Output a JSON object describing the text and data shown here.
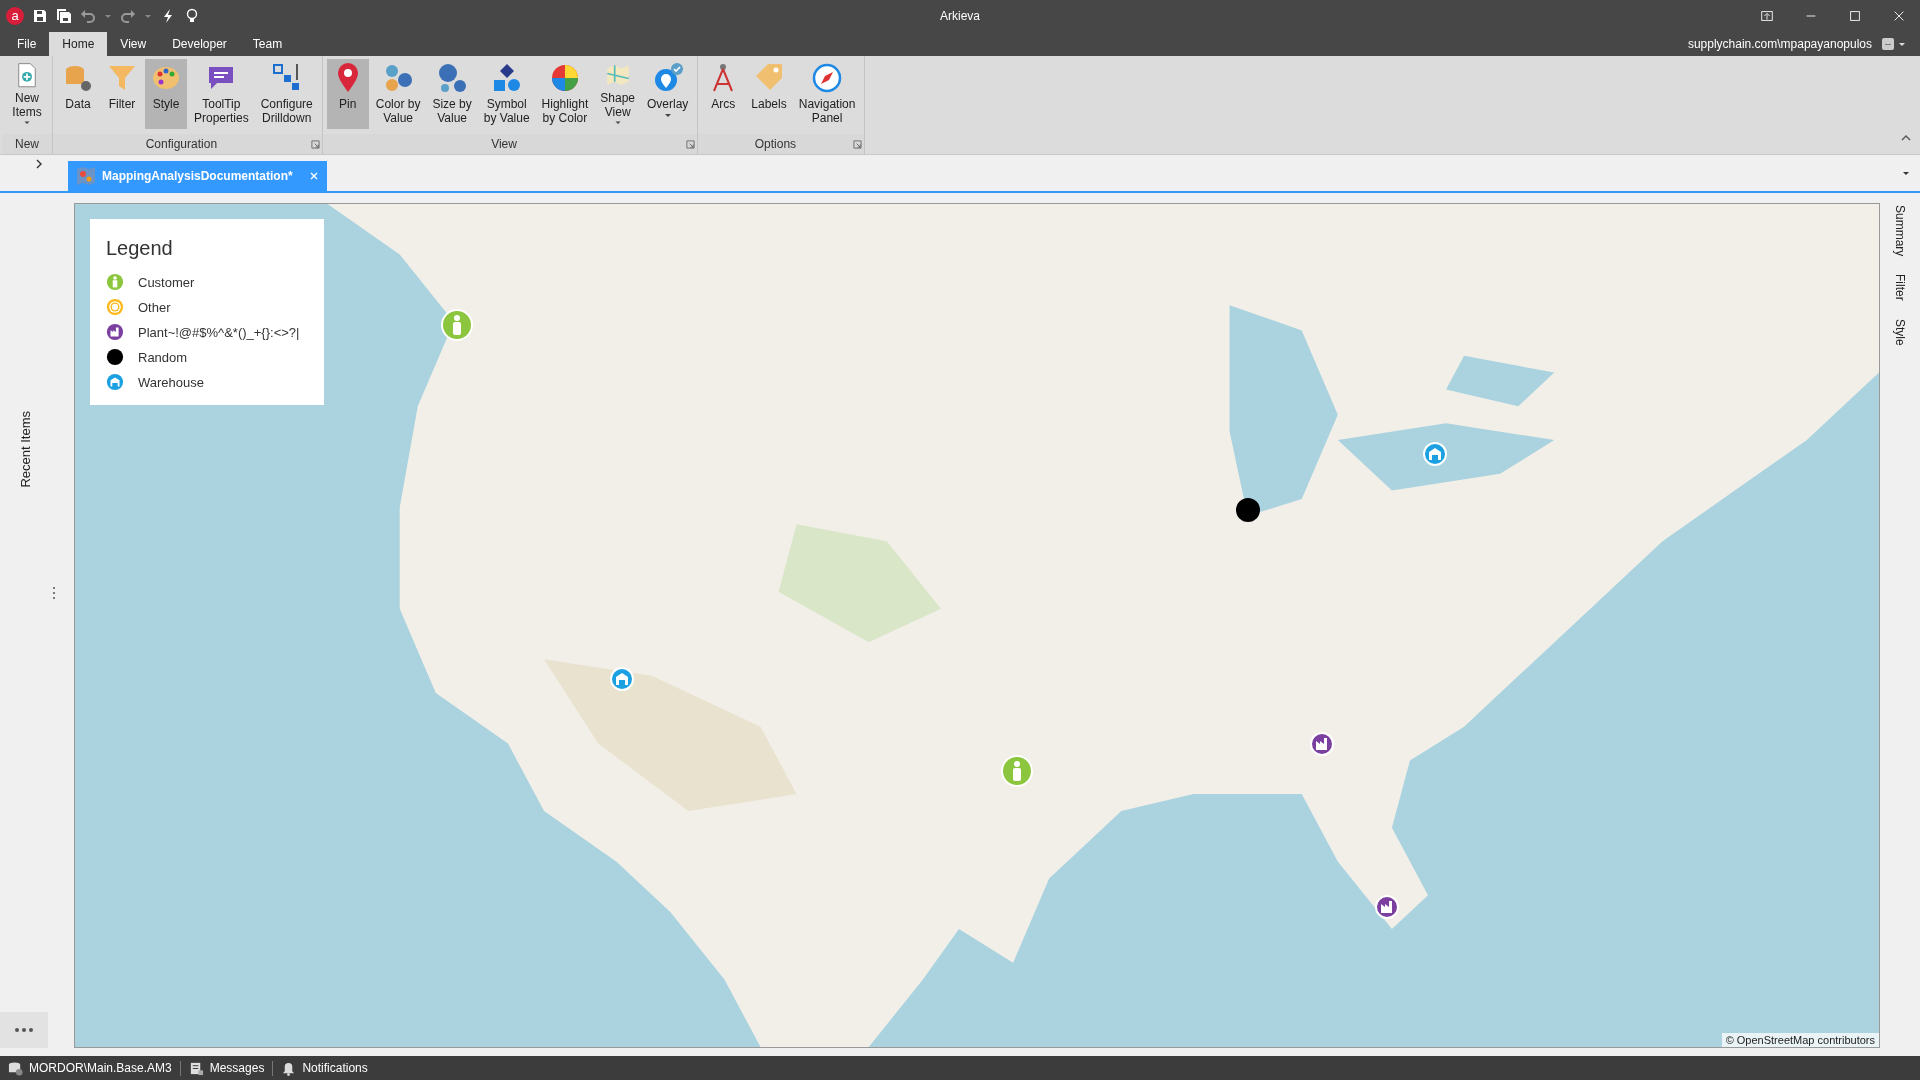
{
  "window": {
    "logo_letter": "a",
    "title": "Arkieva"
  },
  "menu_tabs": [
    {
      "label": "File",
      "selected": false
    },
    {
      "label": "Home",
      "selected": true
    },
    {
      "label": "View",
      "selected": false
    },
    {
      "label": "Developer",
      "selected": false
    },
    {
      "label": "Team",
      "selected": false
    }
  ],
  "account": {
    "user": "supplychain.com\\mpapayanopulos",
    "badge": "--"
  },
  "ribbon_groups": [
    {
      "label": "New",
      "launcher": false,
      "buttons": [
        {
          "kind": "new",
          "lines": [
            "New",
            "Items"
          ],
          "dropdown": true,
          "selected": false
        }
      ]
    },
    {
      "label": "Configuration",
      "launcher": true,
      "buttons": [
        {
          "kind": "data",
          "lines": [
            "Data"
          ],
          "dropdown": false,
          "selected": false
        },
        {
          "kind": "filter",
          "lines": [
            "Filter"
          ],
          "dropdown": false,
          "selected": false
        },
        {
          "kind": "style",
          "lines": [
            "Style"
          ],
          "dropdown": false,
          "selected": true
        },
        {
          "kind": "tooltip",
          "lines": [
            "ToolTip",
            "Properties"
          ],
          "dropdown": false,
          "selected": false
        },
        {
          "kind": "drilldown",
          "lines": [
            "Configure",
            "Drilldown"
          ],
          "dropdown": false,
          "selected": false
        }
      ]
    },
    {
      "label": "View",
      "launcher": true,
      "buttons": [
        {
          "kind": "pin",
          "lines": [
            "Pin"
          ],
          "dropdown": false,
          "selected": true
        },
        {
          "kind": "color",
          "lines": [
            "Color by",
            "Value"
          ],
          "dropdown": false,
          "selected": false
        },
        {
          "kind": "size",
          "lines": [
            "Size by",
            "Value"
          ],
          "dropdown": false,
          "selected": false
        },
        {
          "kind": "symbol",
          "lines": [
            "Symbol",
            "by Value"
          ],
          "dropdown": false,
          "selected": false
        },
        {
          "kind": "highlight",
          "lines": [
            "Highlight",
            "by Color"
          ],
          "dropdown": false,
          "selected": false
        },
        {
          "kind": "shape",
          "lines": [
            "Shape",
            "View"
          ],
          "dropdown": true,
          "selected": false
        },
        {
          "kind": "overlay",
          "lines": [
            "Overlay"
          ],
          "dropdown": true,
          "selected": false
        }
      ]
    },
    {
      "label": "Options",
      "launcher": true,
      "buttons": [
        {
          "kind": "arcs",
          "lines": [
            "Arcs"
          ],
          "dropdown": false,
          "selected": false
        },
        {
          "kind": "labels",
          "lines": [
            "Labels"
          ],
          "dropdown": false,
          "selected": false
        },
        {
          "kind": "navigation",
          "lines": [
            "Navigation",
            "Panel"
          ],
          "dropdown": false,
          "selected": false
        }
      ]
    }
  ],
  "document_tab": {
    "label": "MappingAnalysisDocumentation*"
  },
  "left_panel": {
    "label": "Recent Items"
  },
  "right_panel": {
    "tabs": [
      "Summary",
      "Filter",
      "Style"
    ]
  },
  "legend": {
    "title": "Legend",
    "items": [
      {
        "kind": "customer",
        "label": "Customer",
        "color": "#8cc63f"
      },
      {
        "kind": "other",
        "label": "Other",
        "color": "#fbb817"
      },
      {
        "kind": "plant",
        "label": "Plant~!@#$%^&*()_+{}:<>?|",
        "color": "#7b3fa0"
      },
      {
        "kind": "random",
        "label": "Random",
        "color": "#000000"
      },
      {
        "kind": "warehouse",
        "label": "Warehouse",
        "color": "#1ba1e2"
      }
    ]
  },
  "markers": [
    {
      "kind": "customer"
    },
    {
      "kind": "warehouse"
    },
    {
      "kind": "customer"
    },
    {
      "kind": "random"
    },
    {
      "kind": "warehouse"
    },
    {
      "kind": "plant"
    },
    {
      "kind": "plant"
    }
  ],
  "attribution": "© OpenStreetMap contributors",
  "status_bar": [
    {
      "kind": "database",
      "label": "MORDOR\\Main.Base.AM3"
    },
    {
      "kind": "messages",
      "label": "Messages"
    },
    {
      "kind": "bell",
      "label": "Notifications"
    }
  ]
}
